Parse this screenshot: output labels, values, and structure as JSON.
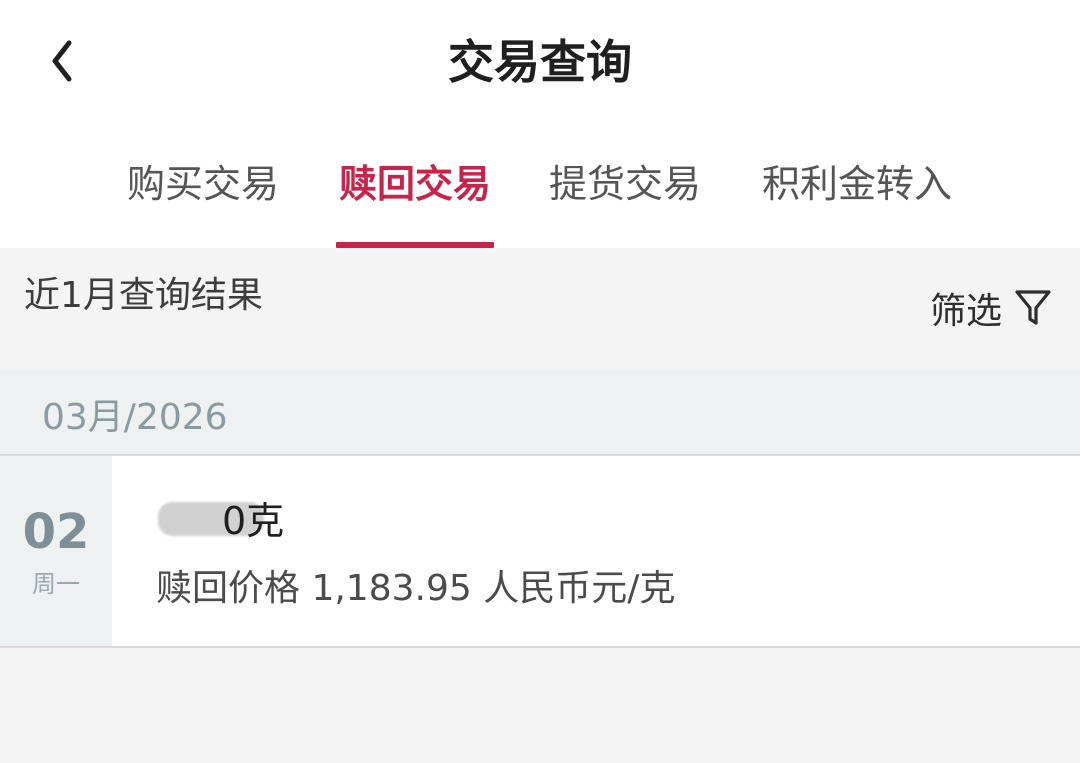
{
  "header": {
    "title": "交易查询",
    "back_icon": "chevron-left-icon"
  },
  "tabs": [
    {
      "label": "购买交易",
      "active": false
    },
    {
      "label": "赎回交易",
      "active": true
    },
    {
      "label": "提货交易",
      "active": false
    },
    {
      "label": "积利金转入",
      "active": false
    }
  ],
  "results": {
    "summary": "近1月查询结果",
    "filter_label": "筛选",
    "filter_icon": "filter-icon"
  },
  "month_group": {
    "label": "03月/2026"
  },
  "transaction": {
    "day": "02",
    "weekday": "周一",
    "amount_visible": "0克",
    "price_line": "赎回价格 1,183.95 人民币元/克"
  },
  "colors": {
    "accent": "#c6244c",
    "page_bg": "#f4f4f4",
    "section_bg": "#eef1f1",
    "text_primary": "#1f1f1f",
    "text_muted": "#8a9aa0"
  }
}
